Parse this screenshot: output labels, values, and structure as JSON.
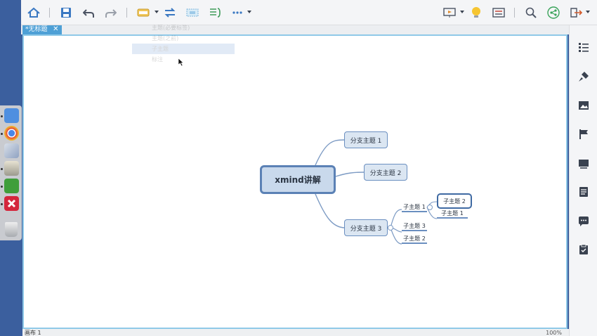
{
  "toolbar": {
    "icons": [
      "home-icon",
      "save-icon",
      "undo-icon",
      "redo-icon",
      "insert-topic-icon",
      "relationship-icon",
      "boundary-icon",
      "summary-icon",
      "more-icon",
      "presentation-icon",
      "idea-icon",
      "outline-icon",
      "search-icon",
      "share-icon",
      "export-icon"
    ]
  },
  "tab": {
    "title": "*无标题",
    "close": "✕"
  },
  "ghost_menu": {
    "items": [
      "主题(必要标签)",
      "主题(之前)",
      "子主题",
      "标注"
    ]
  },
  "map": {
    "central": "xmind讲解",
    "branches": [
      {
        "label": "分支主题 1"
      },
      {
        "label": "分支主题 2"
      },
      {
        "label": "分支主题 3"
      }
    ],
    "subtopics": [
      {
        "label": "子主题 1"
      },
      {
        "label": "子主题 3"
      },
      {
        "label": "子主题 2"
      }
    ],
    "sub_subtopics": [
      {
        "label": "子主题 2"
      },
      {
        "label": "子主题 1"
      }
    ]
  },
  "rightbar": {
    "icons": [
      "outline-list-icon",
      "format-brush-icon",
      "image-icon",
      "marker-flag-icon",
      "text-style-icon",
      "notes-icon",
      "comments-icon",
      "task-icon"
    ]
  },
  "status": {
    "sheet": "画布 1",
    "zoom": "100%"
  },
  "colors": {
    "accent": "#4ea0d6",
    "node_fill": "#c9d9ec",
    "node_border": "#5b81b5",
    "line": "#7d9bc4"
  }
}
